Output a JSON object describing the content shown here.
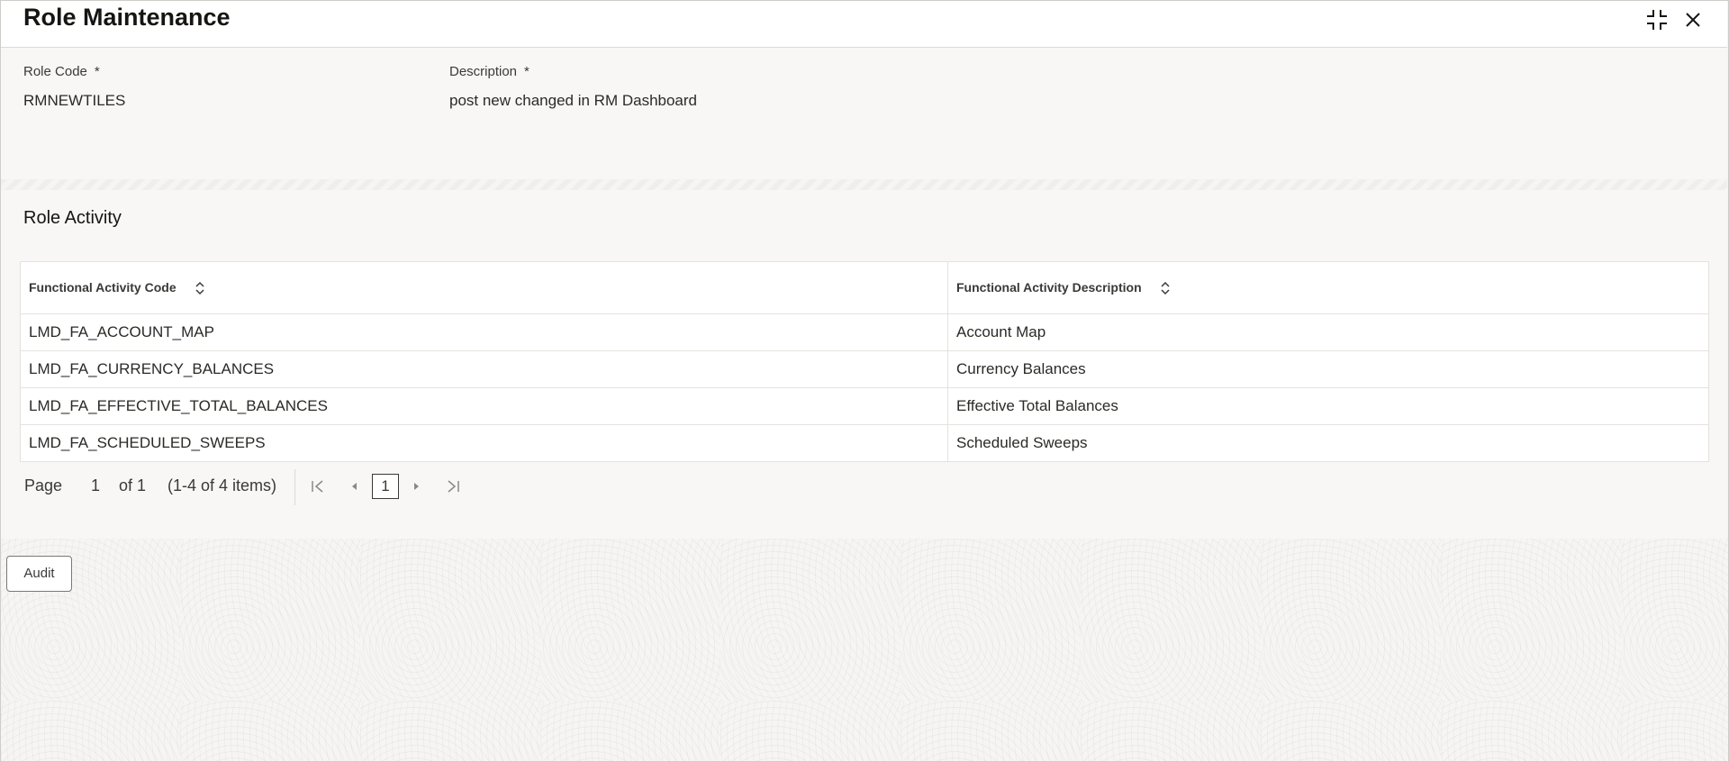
{
  "header": {
    "title": "Role Maintenance"
  },
  "form": {
    "role_code": {
      "label": "Role Code",
      "required_mark": "*",
      "value": "RMNEWTILES"
    },
    "description": {
      "label": "Description",
      "required_mark": "*",
      "value": "post new changed in RM Dashboard"
    }
  },
  "role_activity": {
    "title": "Role Activity",
    "columns": [
      "Functional Activity Code",
      "Functional Activity Description"
    ],
    "rows": [
      [
        "LMD_FA_ACCOUNT_MAP",
        "Account Map"
      ],
      [
        "LMD_FA_CURRENCY_BALANCES",
        "Currency Balances"
      ],
      [
        "LMD_FA_EFFECTIVE_TOTAL_BALANCES",
        "Effective Total Balances"
      ],
      [
        "LMD_FA_SCHEDULED_SWEEPS",
        "Scheduled Sweeps"
      ]
    ],
    "pager": {
      "page_label": "Page",
      "page_value": "1",
      "of_label": "of 1",
      "items_label": "(1-4 of 4 items)",
      "current_page": "1"
    }
  },
  "footer": {
    "audit_label": "Audit"
  },
  "icons": [
    "minimize-icon",
    "close-icon",
    "sort-icon",
    "first-page-icon",
    "previous-page-icon",
    "next-page-icon",
    "last-page-icon"
  ]
}
